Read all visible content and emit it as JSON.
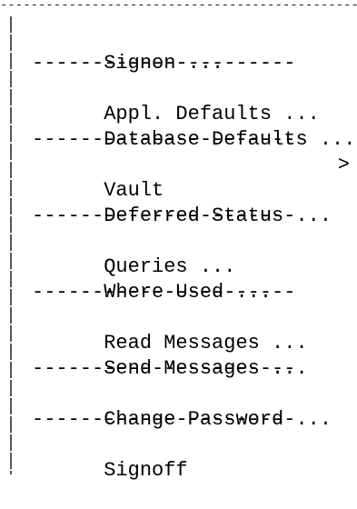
{
  "frame": {
    "top_border": "------------------------------------------------------------------------",
    "separator": "----------------------"
  },
  "menu": {
    "items": [
      {
        "type": "item",
        "label": "Signon ..."
      },
      {
        "type": "separator"
      },
      {
        "type": "item",
        "label": "Appl. Defaults ..."
      },
      {
        "type": "item",
        "label": "Database Defaults ..."
      },
      {
        "type": "separator"
      },
      {
        "type": "item",
        "label": "Vault",
        "submenu_indicator": ">"
      },
      {
        "type": "item",
        "label": "Deferred Status ..."
      },
      {
        "type": "separator"
      },
      {
        "type": "item",
        "label": "Queries ..."
      },
      {
        "type": "item",
        "label": "Where Used ..."
      },
      {
        "type": "separator"
      },
      {
        "type": "item",
        "label": "Read Messages ..."
      },
      {
        "type": "item",
        "label": "Send Messages ..."
      },
      {
        "type": "separator"
      },
      {
        "type": "item",
        "label": "Change Password ..."
      },
      {
        "type": "separator"
      },
      {
        "type": "item",
        "label": "Signoff"
      }
    ]
  }
}
